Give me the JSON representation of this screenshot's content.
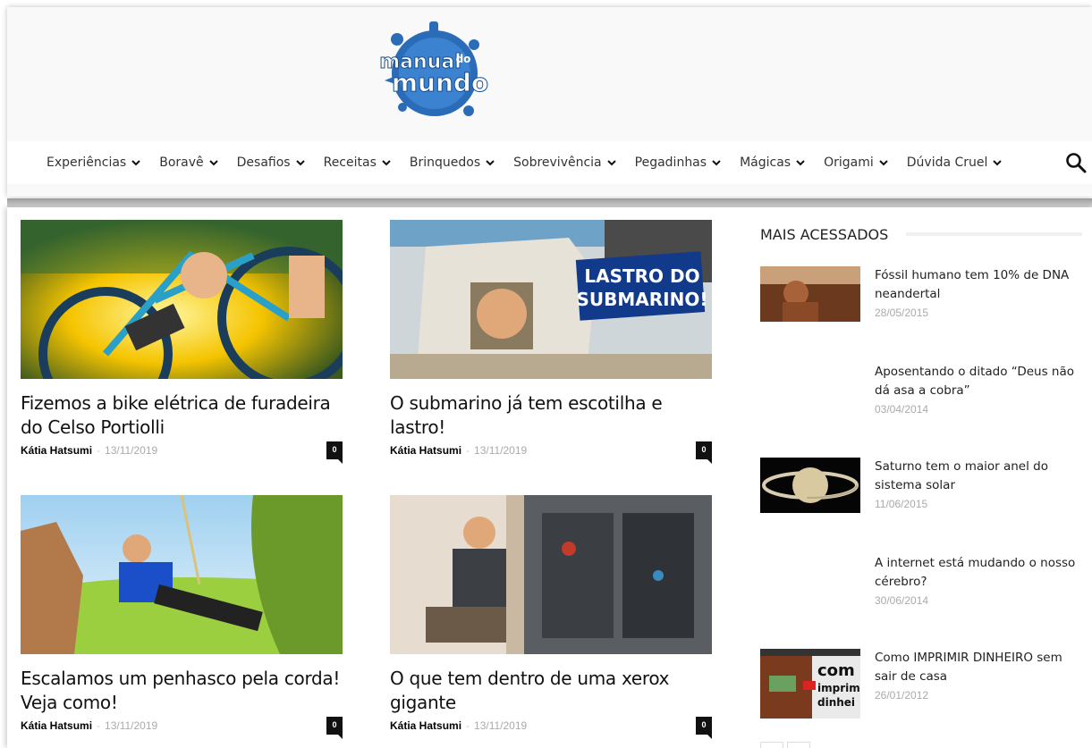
{
  "logo": {
    "text_top": "manual",
    "text_small": "do",
    "text_main": "mundo"
  },
  "nav": {
    "items": [
      {
        "label": "Experiências"
      },
      {
        "label": "Boravê"
      },
      {
        "label": "Desafios"
      },
      {
        "label": "Receitas"
      },
      {
        "label": "Brinquedos"
      },
      {
        "label": "Sobrevivência"
      },
      {
        "label": "Pegadinhas"
      },
      {
        "label": "Mágicas"
      },
      {
        "label": "Origami"
      },
      {
        "label": "Dúvida Cruel"
      }
    ]
  },
  "articles": [
    {
      "title": "Fizemos a bike elétrica de furadeira do Celso Portiolli",
      "author": "Kátia Hatsumi",
      "sep": "-",
      "date": "13/11/2019",
      "comments": "0"
    },
    {
      "title": "O submarino já tem escotilha e lastro!",
      "author": "Kátia Hatsumi",
      "sep": "-",
      "date": "13/11/2019",
      "comments": "0",
      "overlay_line1": "LASTRO DO",
      "overlay_line2": "SUBMARINO!"
    },
    {
      "title": "Escalamos um penhasco pela corda! Veja como!",
      "author": "Kátia Hatsumi",
      "sep": "-",
      "date": "13/11/2019",
      "comments": "0"
    },
    {
      "title": "O que tem dentro de uma xerox gigante",
      "author": "Kátia Hatsumi",
      "sep": "-",
      "date": "13/11/2019",
      "comments": "0"
    }
  ],
  "sidebar": {
    "heading": "MAIS ACESSADOS",
    "items": [
      {
        "title": "Fóssil humano tem 10% de DNA neandertal",
        "date": "28/05/2015"
      },
      {
        "title": "Aposentando o ditado “Deus não dá asa a cobra”",
        "date": "03/04/2014"
      },
      {
        "title": "Saturno tem o maior anel do sistema solar",
        "date": "11/06/2015"
      },
      {
        "title": "A internet está mudando o nosso cérebro?",
        "date": "30/06/2014"
      },
      {
        "title": "Como IMPRIMIR DINHEIRO sem sair de casa",
        "date": "26/01/2012",
        "thumb_text1": "com",
        "thumb_text2": "imprim",
        "thumb_text3": "dinhei"
      }
    ]
  },
  "colors": {
    "accent": "#2b6cb8",
    "text": "#111111",
    "date": "#aaaaaa",
    "header_bg": "#f9f9f9"
  }
}
